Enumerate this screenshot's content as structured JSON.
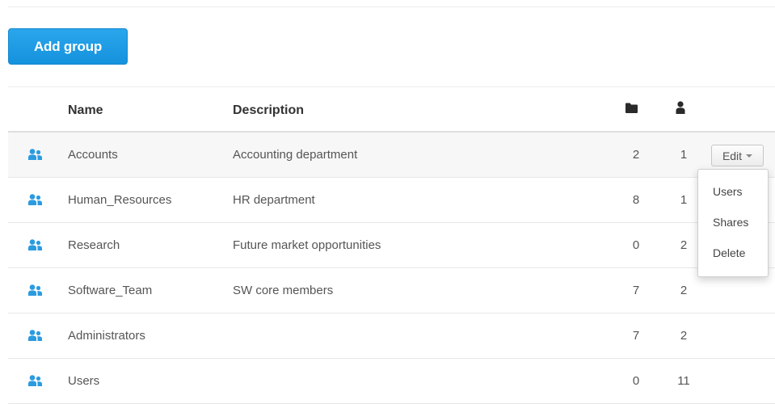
{
  "toolbar": {
    "add_group_label": "Add group"
  },
  "table": {
    "columns": {
      "name": "Name",
      "description": "Description",
      "shares_icon": "folder-icon",
      "users_icon": "person-icon"
    },
    "rows": [
      {
        "name": "Accounts",
        "description": "Accounting department",
        "shares": "2",
        "users": "1"
      },
      {
        "name": "Human_Resources",
        "description": "HR department",
        "shares": "8",
        "users": "1"
      },
      {
        "name": "Research",
        "description": "Future market opportunities",
        "shares": "0",
        "users": "2"
      },
      {
        "name": "Software_Team",
        "description": "SW core members",
        "shares": "7",
        "users": "2"
      },
      {
        "name": "Administrators",
        "description": "",
        "shares": "7",
        "users": "2"
      },
      {
        "name": "Users",
        "description": "",
        "shares": "0",
        "users": "11"
      }
    ],
    "row_icon": "group-icon"
  },
  "row_actions": {
    "edit_label": "Edit"
  },
  "edit_menu": {
    "items": [
      "Users",
      "Shares",
      "Delete"
    ]
  },
  "colors": {
    "accent": "#1a9be6",
    "group_icon": "#2b9be0"
  }
}
